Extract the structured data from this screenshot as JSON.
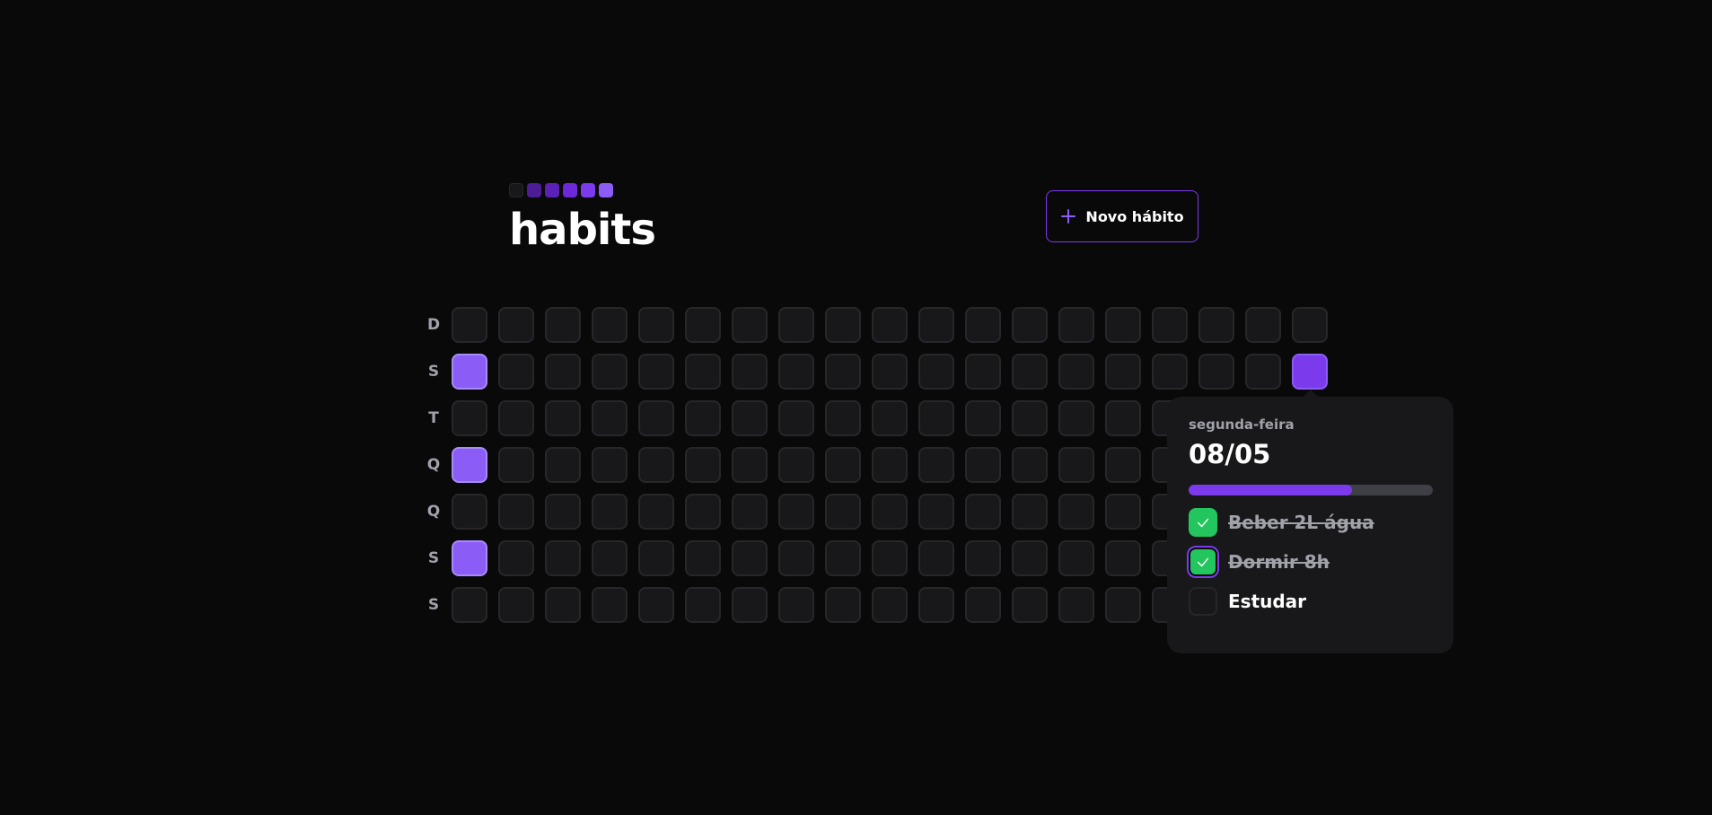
{
  "app": {
    "title": "habits",
    "logo_colors": [
      "#18181b",
      "#4c1d95",
      "#5b21b6",
      "#6d28d9",
      "#7c3aed",
      "#8b5cf6"
    ]
  },
  "header": {
    "new_habit_label": "Novo hábito",
    "new_habit_icon": "plus-icon"
  },
  "weekdays": [
    "D",
    "S",
    "T",
    "Q",
    "Q",
    "S",
    "S"
  ],
  "summary": {
    "columns": 19,
    "completed_days": [
      {
        "week": 0,
        "weekday": 1,
        "level": 5
      },
      {
        "week": 0,
        "weekday": 3,
        "level": 5
      },
      {
        "week": 0,
        "weekday": 5,
        "level": 5
      },
      {
        "week": 18,
        "weekday": 1,
        "level": 4
      }
    ]
  },
  "popover": {
    "weekday": "segunda-feira",
    "date": "08/05",
    "progress_percent": 67,
    "habits": [
      {
        "title": "Beber 2L água",
        "completed": true
      },
      {
        "title": "Dormir 8h",
        "completed": true
      },
      {
        "title": "Estudar",
        "completed": false
      }
    ]
  },
  "colors": {
    "accent": "#7c3aed",
    "check_green": "#22c55e",
    "background": "#09090a"
  }
}
